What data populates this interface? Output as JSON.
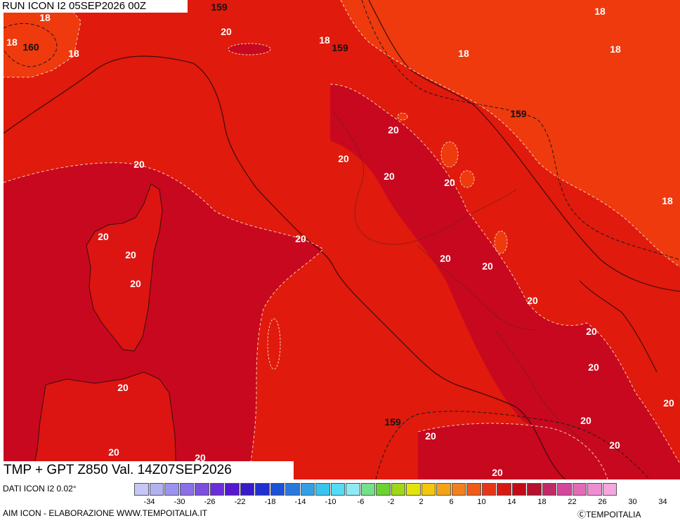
{
  "header": {
    "run_label": "RUN ICON I2 05SEP2026 00Z"
  },
  "title": "TMP + GPT Z850 Val. 14Z07SEP2026",
  "source_label": "DATI ICON I2 0.02°",
  "footer": {
    "left": "AIM ICON - ELABORAZIONE WWW.TEMPOITALIA.IT",
    "right": "ⒸTEMPOITALIA"
  },
  "colors": {
    "t18": "#ef3a0e",
    "t20": "#e01a0c",
    "t22": "#c8081e",
    "coast": "#3a0d0d",
    "contour": "#1a1a1a",
    "isotherm": "#f3c7b5"
  },
  "legend": {
    "ticks": [
      "-34",
      "-30",
      "-26",
      "-22",
      "-18",
      "-14",
      "-10",
      "-6",
      "-2",
      "2",
      "6",
      "10",
      "14",
      "18",
      "22",
      "26",
      "30",
      "34"
    ],
    "colors": [
      "#c6c6f7",
      "#b2b2f1",
      "#9b93ef",
      "#8a6fe8",
      "#7b4fe0",
      "#6b2fd8",
      "#5518cf",
      "#3b1ac9",
      "#2230d0",
      "#1c52d6",
      "#2a78de",
      "#33a0e6",
      "#38c4ef",
      "#52dcf6",
      "#8ee9f2",
      "#76df8c",
      "#6cd232",
      "#9ed819",
      "#e4e30c",
      "#f4c60e",
      "#f4a316",
      "#f1801e",
      "#ef5a1a",
      "#e8351a",
      "#d71a15",
      "#c40a18",
      "#b3112d",
      "#c22a66",
      "#d4479a",
      "#e26ab6",
      "#ee8ed0",
      "#f6a6de"
    ]
  },
  "map_labels": {
    "temps": [
      {
        "text": "18"
      },
      {
        "text": "18"
      },
      {
        "text": "18"
      },
      {
        "text": "18"
      },
      {
        "text": "18"
      },
      {
        "text": "18"
      },
      {
        "text": "18"
      },
      {
        "text": "18"
      },
      {
        "text": "20"
      },
      {
        "text": "20"
      },
      {
        "text": "20"
      },
      {
        "text": "20"
      },
      {
        "text": "20"
      },
      {
        "text": "20"
      },
      {
        "text": "20"
      },
      {
        "text": "20"
      },
      {
        "text": "20"
      },
      {
        "text": "20"
      },
      {
        "text": "20"
      },
      {
        "text": "20"
      },
      {
        "text": "20"
      },
      {
        "text": "20"
      },
      {
        "text": "20"
      },
      {
        "text": "20"
      },
      {
        "text": "20"
      },
      {
        "text": "20"
      },
      {
        "text": "20"
      },
      {
        "text": "20"
      },
      {
        "text": "20"
      },
      {
        "text": "20"
      },
      {
        "text": "20"
      }
    ],
    "gpt": [
      {
        "text": "159"
      },
      {
        "text": "160"
      },
      {
        "text": "159"
      },
      {
        "text": "159"
      },
      {
        "text": "159"
      }
    ]
  }
}
